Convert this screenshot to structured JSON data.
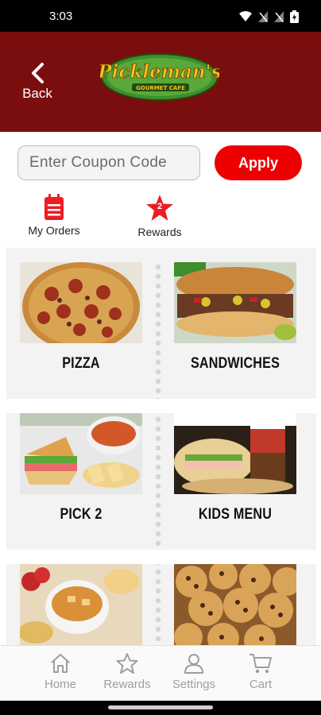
{
  "status_bar": {
    "time": "3:03"
  },
  "header": {
    "back_label": "Back",
    "logo_text": "Pickleman's",
    "logo_subtext": "GOURMET CAFE"
  },
  "coupon": {
    "placeholder": "Enter Coupon Code",
    "apply_label": "Apply"
  },
  "shortcuts": {
    "orders_label": "My Orders",
    "rewards_label": "Rewards",
    "rewards_count": "2"
  },
  "menu": {
    "items": [
      {
        "name": "PIZZA"
      },
      {
        "name": "SANDWICHES"
      },
      {
        "name": "PICK 2"
      },
      {
        "name": "KIDS MENU"
      }
    ]
  },
  "tabs": [
    {
      "label": "Home"
    },
    {
      "label": "Rewards"
    },
    {
      "label": "Settings"
    },
    {
      "label": "Cart"
    }
  ],
  "colors": {
    "header_bg": "#7a0d0d",
    "accent_red": "#ee0000",
    "tab_inactive": "#9e9e9e"
  }
}
